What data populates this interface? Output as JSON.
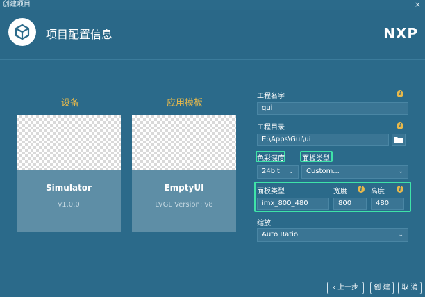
{
  "window": {
    "title": "创建项目",
    "close_glyph": "×"
  },
  "header": {
    "title": "项目配置信息",
    "brand": "NXP",
    "logo_icon": "cube-icon"
  },
  "devices": {
    "title": "设备",
    "card": {
      "name": "Simulator",
      "version": "v1.0.0"
    }
  },
  "templates": {
    "title": "应用模板",
    "card": {
      "name": "EmptyUI",
      "version": "LVGL Version: v8"
    }
  },
  "form": {
    "project_name": {
      "label": "工程名字",
      "value": "gui"
    },
    "project_dir": {
      "label": "工程目录",
      "value": "E:\\Apps\\Gui\\ui"
    },
    "color_depth": {
      "label": "色彩深度",
      "value": "24bit"
    },
    "panel_type": {
      "label": "面板类型",
      "value": "Custom..."
    },
    "panel": {
      "type_label": "面板类型",
      "type_value": "imx_800_480",
      "width_label": "宽度",
      "width_value": "800",
      "height_label": "高度",
      "height_value": "480"
    },
    "scale": {
      "label": "缩放",
      "value": "Auto Ratio"
    }
  },
  "footer": {
    "prev": "上一步",
    "prev_icon": "chevron-left-icon",
    "create": "创 建",
    "cancel": "取 消"
  },
  "colors": {
    "background": "#2b6a8a",
    "accent": "#e6b94c",
    "highlight": "#3fe3a8",
    "card": "#5e8ea6"
  }
}
